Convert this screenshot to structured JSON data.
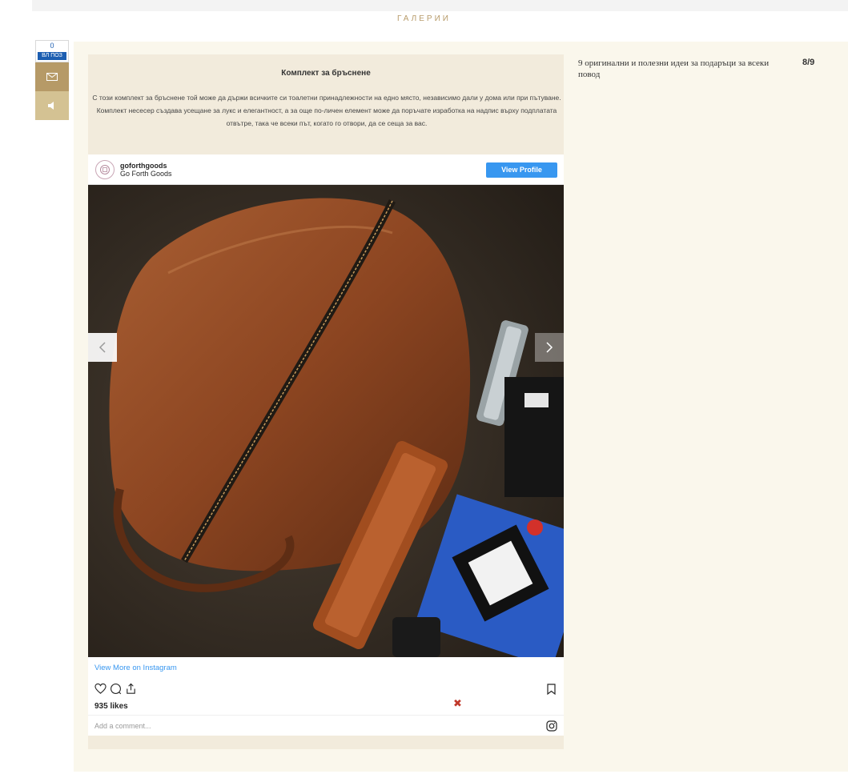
{
  "gallery": {
    "title": "ГАЛЕРИИ"
  },
  "share": {
    "count": "0",
    "label": "ВЛ ПОЗ"
  },
  "card": {
    "title": "Комплект за бръснене",
    "description": "С този комплект за бръснене той може да държи всичките си тоалетни принадлежности на едно място, независимо дали у дома или при пътуване. Комплект несесер създава усещане за лукс и елегантност, а за още по-личен елемент може да поръчате изработка на надпис върху подплатата отвътре, така че всеки път, когато го отвори, да се сеща за вас."
  },
  "instagram": {
    "handle": "goforthgoods",
    "name": "Go Forth Goods",
    "view_profile": "View Profile",
    "view_more": "View More on Instagram",
    "likes": "935 likes",
    "comment_placeholder": "Add a comment..."
  },
  "sidebar": {
    "article_title": "9 оригинални и полезни идеи за подаръци за всеки повод",
    "counter": "8/9"
  },
  "colors": {
    "accent": "#b69a67",
    "ig_blue": "#3897f0",
    "panel": "#faf7ec"
  }
}
